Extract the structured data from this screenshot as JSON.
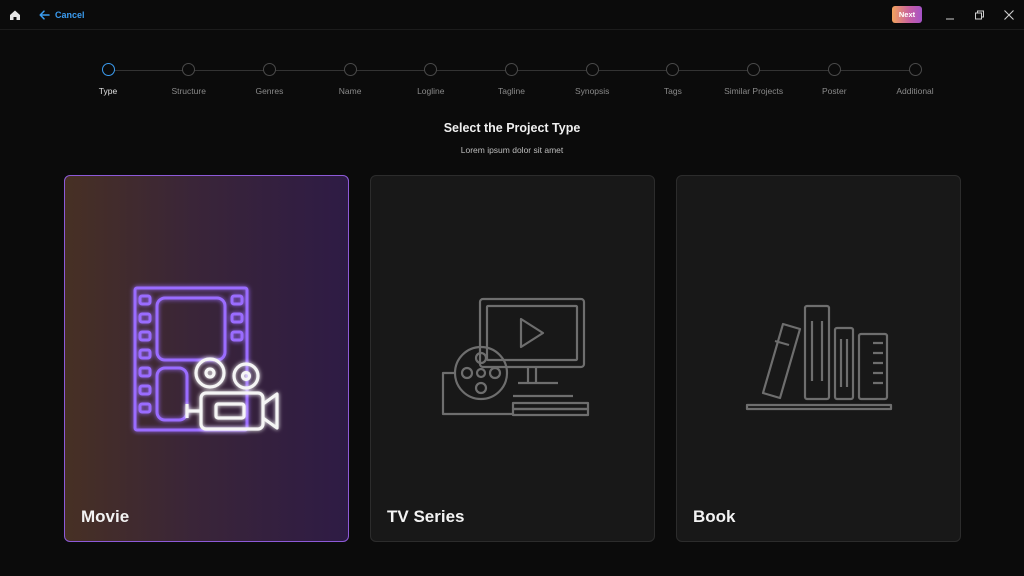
{
  "titlebar": {
    "home_icon": "home-icon",
    "cancel_label": "Cancel",
    "next_label": "Next",
    "accent_color": "#3b9cf0"
  },
  "steps": [
    {
      "label": "Type",
      "active": true
    },
    {
      "label": "Structure",
      "active": false
    },
    {
      "label": "Genres",
      "active": false
    },
    {
      "label": "Name",
      "active": false
    },
    {
      "label": "Logline",
      "active": false
    },
    {
      "label": "Tagline",
      "active": false
    },
    {
      "label": "Synopsis",
      "active": false
    },
    {
      "label": "Tags",
      "active": false
    },
    {
      "label": "Similar Projects",
      "active": false
    },
    {
      "label": "Poster",
      "active": false
    },
    {
      "label": "Additional",
      "active": false
    }
  ],
  "main": {
    "title": "Select the Project Type",
    "subtitle": "Lorem ipsum dolor sit amet"
  },
  "cards": [
    {
      "label": "Movie",
      "icon": "film-camera-icon",
      "selected": true
    },
    {
      "label": "TV Series",
      "icon": "tv-reel-icon",
      "selected": false
    },
    {
      "label": "Book",
      "icon": "books-icon",
      "selected": false
    }
  ]
}
